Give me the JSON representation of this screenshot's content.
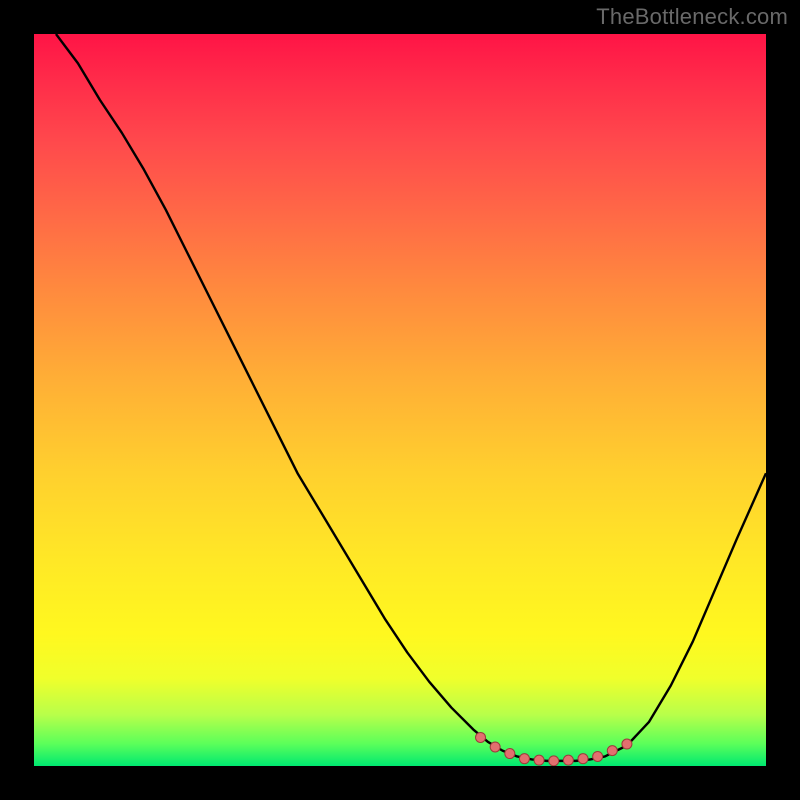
{
  "watermark": "TheBottleneck.com",
  "gradient_colors": {
    "top": "#ff1446",
    "mid_upper": "#ff8a3e",
    "mid_lower": "#ffe826",
    "bottom": "#00e870"
  },
  "curve_color": "#000000",
  "curve_width": 2.4,
  "marker_color": "#e26f6f",
  "marker_stroke": "#9c3b3b",
  "marker_radius": 5,
  "chart_data": {
    "type": "line",
    "title": "",
    "xlabel": "",
    "ylabel": "",
    "xlim": [
      0,
      100
    ],
    "ylim": [
      0,
      100
    ],
    "x": [
      3,
      6,
      9,
      12,
      15,
      18,
      21,
      24,
      27,
      30,
      33,
      36,
      39,
      42,
      45,
      48,
      51,
      54,
      57,
      60,
      62,
      64,
      66,
      68,
      70,
      72,
      74,
      76,
      78,
      81,
      84,
      87,
      90,
      93,
      96,
      100
    ],
    "y": [
      100,
      96,
      91,
      86.5,
      81.5,
      76,
      70,
      64,
      58,
      52,
      46,
      40,
      35,
      30,
      25,
      20,
      15.5,
      11.5,
      8,
      5,
      3.3,
      2.1,
      1.3,
      0.9,
      0.7,
      0.7,
      0.7,
      0.9,
      1.3,
      2.8,
      6,
      11,
      17,
      24,
      31,
      40
    ],
    "marker_points": [
      {
        "x": 61,
        "y": 3.9
      },
      {
        "x": 63,
        "y": 2.6
      },
      {
        "x": 65,
        "y": 1.7
      },
      {
        "x": 67,
        "y": 1.0
      },
      {
        "x": 69,
        "y": 0.8
      },
      {
        "x": 71,
        "y": 0.7
      },
      {
        "x": 73,
        "y": 0.8
      },
      {
        "x": 75,
        "y": 1.0
      },
      {
        "x": 77,
        "y": 1.3
      },
      {
        "x": 79,
        "y": 2.1
      },
      {
        "x": 81,
        "y": 3.0
      }
    ],
    "annotations": [],
    "legend": []
  }
}
